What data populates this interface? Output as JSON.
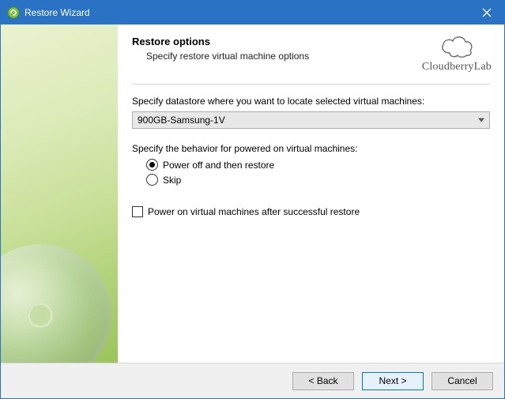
{
  "window": {
    "title": "Restore Wizard"
  },
  "header": {
    "title": "Restore options",
    "subtitle": "Specify restore virtual machine options"
  },
  "brand": {
    "name": "CloudberryLab"
  },
  "datastore": {
    "label": "Specify datastore where you want to locate selected virtual machines:",
    "selected": "900GB-Samsung-1V"
  },
  "behavior": {
    "label": "Specify the behavior for powered on virtual machines:",
    "options": {
      "power_off": "Power off and then restore",
      "skip": "Skip"
    },
    "selected": "power_off"
  },
  "power_on_after": {
    "label": "Power on virtual machines after successful restore",
    "checked": false
  },
  "footer": {
    "back": "< Back",
    "next": "Next >",
    "cancel": "Cancel"
  }
}
